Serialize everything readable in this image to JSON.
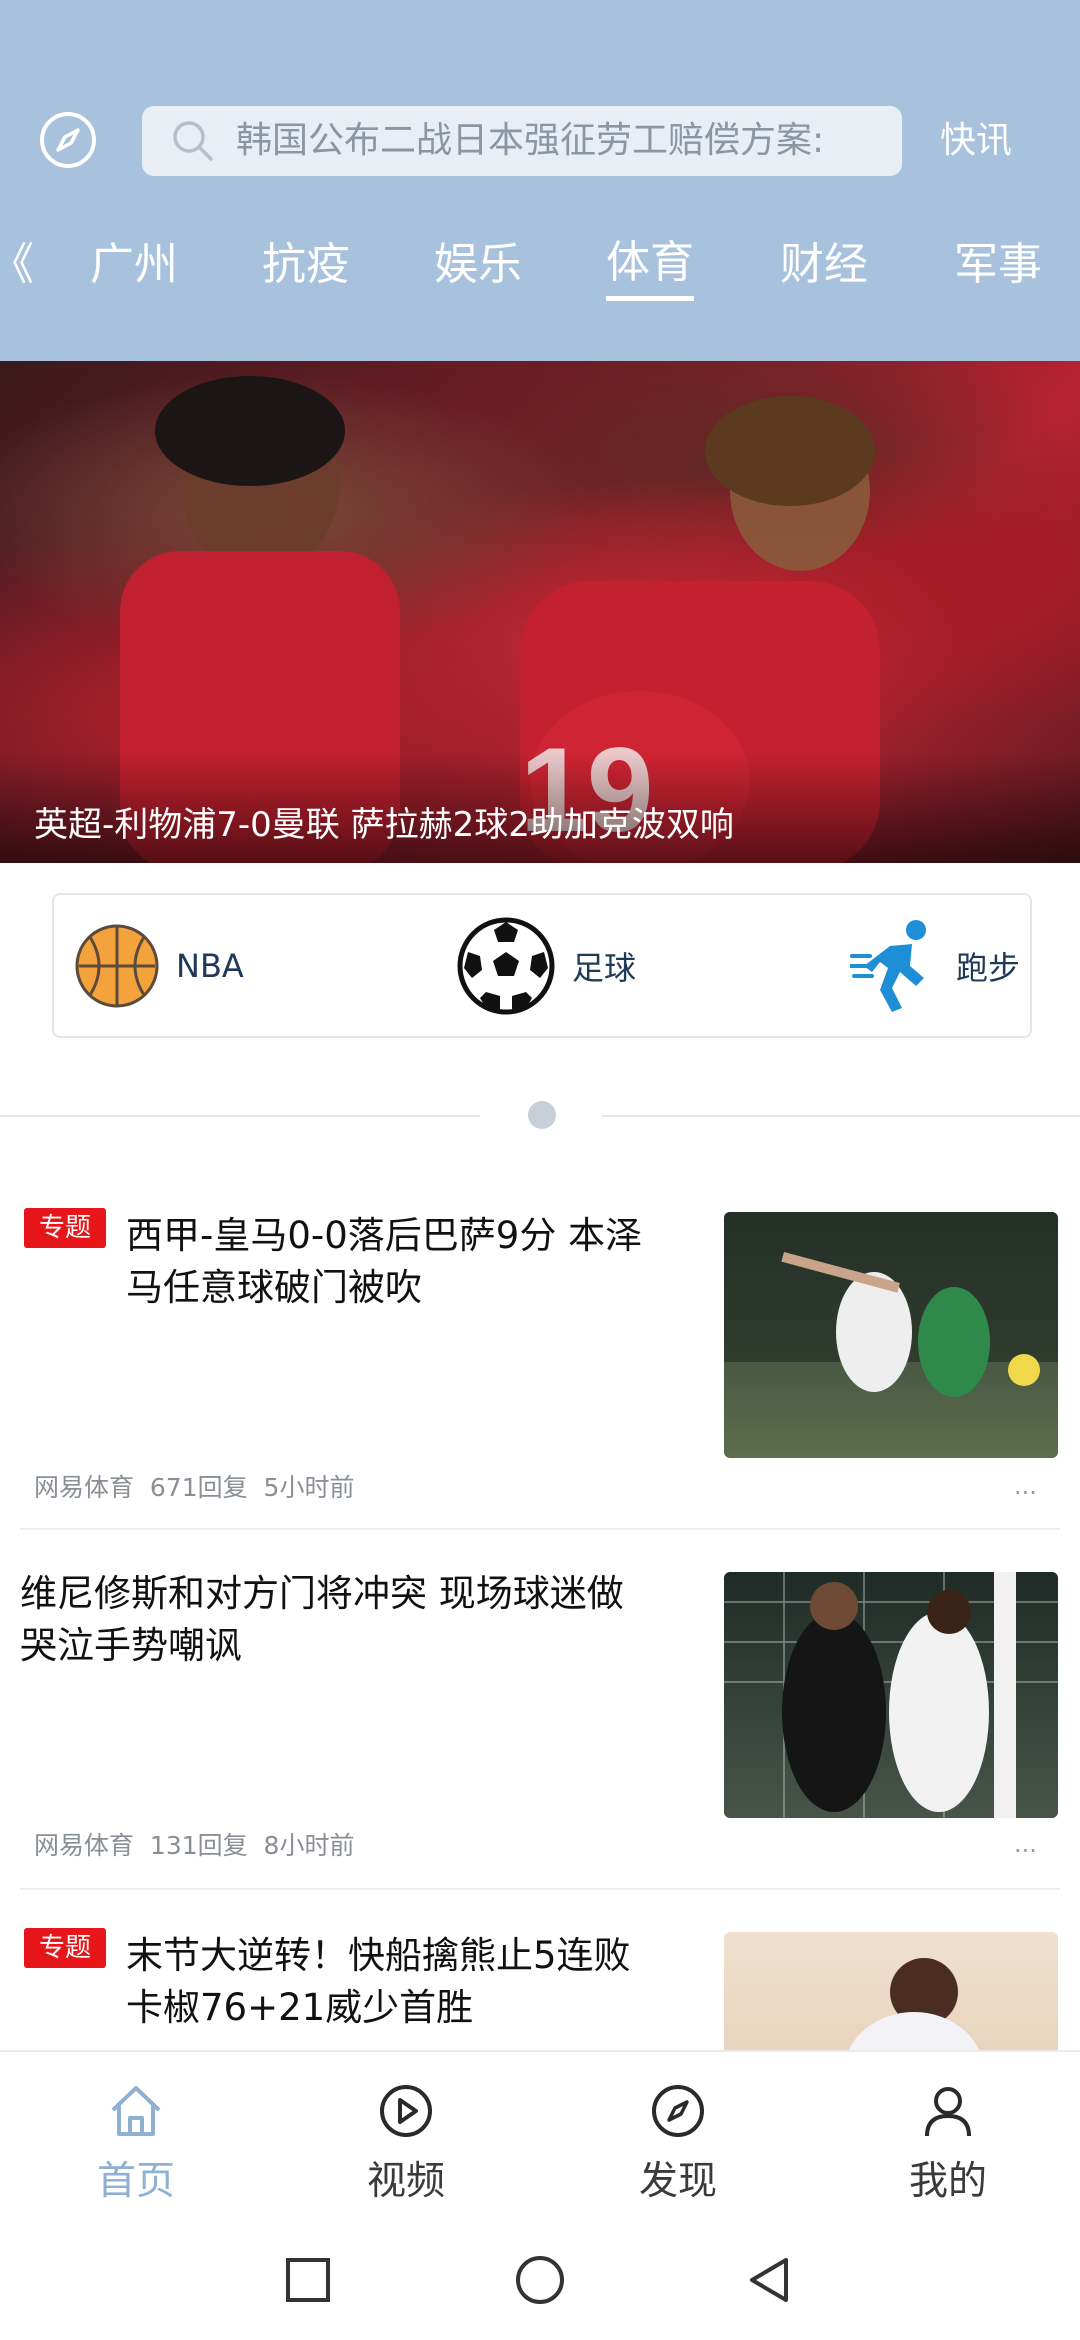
{
  "header": {
    "search_placeholder": "韩国公布二战日本强征劳工赔偿方案:",
    "flash_label": "快讯",
    "tabs": [
      {
        "label": "广州"
      },
      {
        "label": "抗疫"
      },
      {
        "label": "娱乐"
      },
      {
        "label": "体育"
      },
      {
        "label": "财经"
      },
      {
        "label": "军事"
      }
    ],
    "active_tab": "体育",
    "tab_edge_partial": "《"
  },
  "hero": {
    "caption": "英超-利物浦7-0曼联 萨拉赫2球2助加克波双响"
  },
  "sports": [
    {
      "label": "NBA",
      "icon": "basketball-icon"
    },
    {
      "label": "足球",
      "icon": "soccer-ball-icon"
    },
    {
      "label": "跑步",
      "icon": "runner-icon"
    }
  ],
  "news": [
    {
      "badge": "专题",
      "title_line1": "西甲-皇马0-0落后巴萨9分 本泽",
      "title_line2": "马任意球破门被吹",
      "source": "网易体育",
      "replies": "671回复",
      "time": "5小时前",
      "more": "..."
    },
    {
      "badge": "",
      "title_line1": "维尼修斯和对方门将冲突 现场球迷做",
      "title_line2": "哭泣手势嘲讽",
      "source": "网易体育",
      "replies": "131回复",
      "time": "8小时前",
      "more": "..."
    },
    {
      "badge": "专题",
      "title_line1": "末节大逆转！快船擒熊止5连败",
      "title_line2": "卡椒76+21威少首胜"
    }
  ],
  "bottom_nav": [
    {
      "label": "首页",
      "icon": "home-icon",
      "active": true
    },
    {
      "label": "视频",
      "icon": "play-icon",
      "active": false
    },
    {
      "label": "发现",
      "icon": "compass-icon",
      "active": false
    },
    {
      "label": "我的",
      "icon": "user-icon",
      "active": false
    }
  ],
  "colors": {
    "header_bg": "#a8c2de",
    "badge_red": "#e6161a",
    "nav_active": "#8fb0d2"
  }
}
